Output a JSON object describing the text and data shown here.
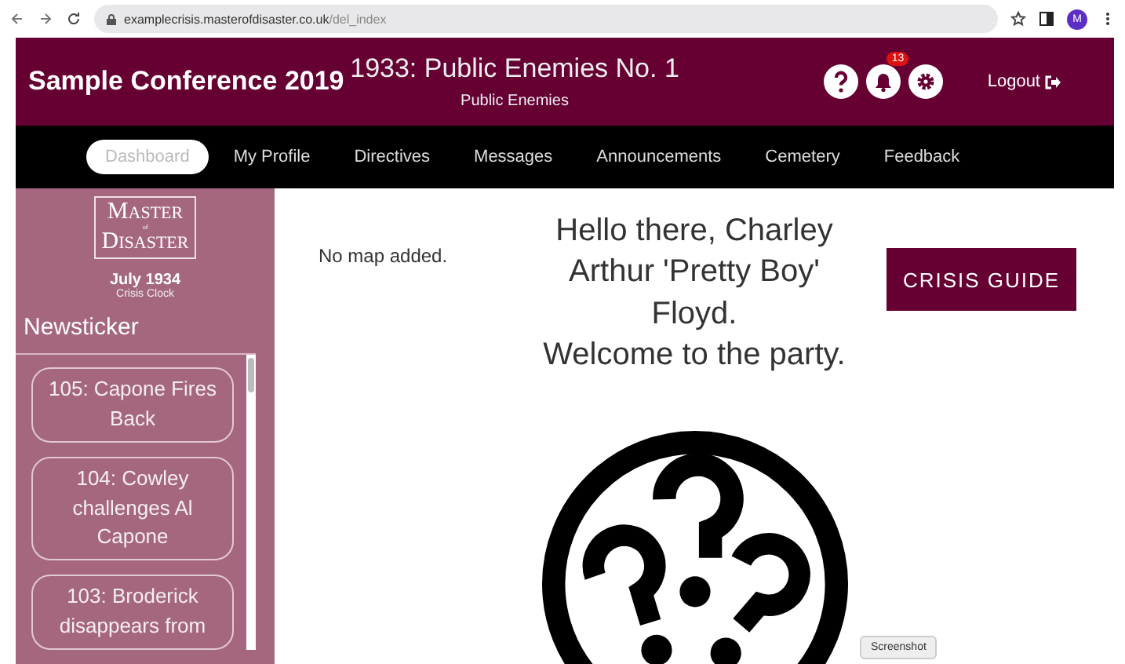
{
  "browser": {
    "url_host": "examplecrisis.masterofdisaster.co.uk",
    "url_path": "/del_index",
    "profile": "M"
  },
  "header": {
    "title": "Sample Conference 2019",
    "crisis": "1933: Public Enemies No. 1",
    "committee": "Public Enemies",
    "notification_count": "13",
    "logout": "Logout"
  },
  "nav": [
    {
      "label": "Dashboard",
      "selected": true
    },
    {
      "label": "My Profile",
      "selected": false
    },
    {
      "label": "Directives",
      "selected": false
    },
    {
      "label": "Messages",
      "selected": false
    },
    {
      "label": "Announcements",
      "selected": false
    },
    {
      "label": "Cemetery",
      "selected": false
    },
    {
      "label": "Feedback",
      "selected": false
    }
  ],
  "sidebar": {
    "logo_top": "MASTER",
    "logo_mid": "of",
    "logo_bottom": "DISASTER",
    "date": "July 1934",
    "clock_label": "Crisis Clock",
    "heading": "Newsticker",
    "news": [
      {
        "title": "105: Capone Fires Back"
      },
      {
        "title": "104: Cowley challenges Al Capone"
      },
      {
        "title": "103: Broderick disappears from"
      }
    ]
  },
  "content": {
    "map_note": "No map added.",
    "greeting": "Hello there, Charley Arthur 'Pretty Boy' Floyd.",
    "welcome": "Welcome to the party.",
    "guide_button": "CRISIS GUIDE"
  },
  "tooltip": "Screenshot"
}
